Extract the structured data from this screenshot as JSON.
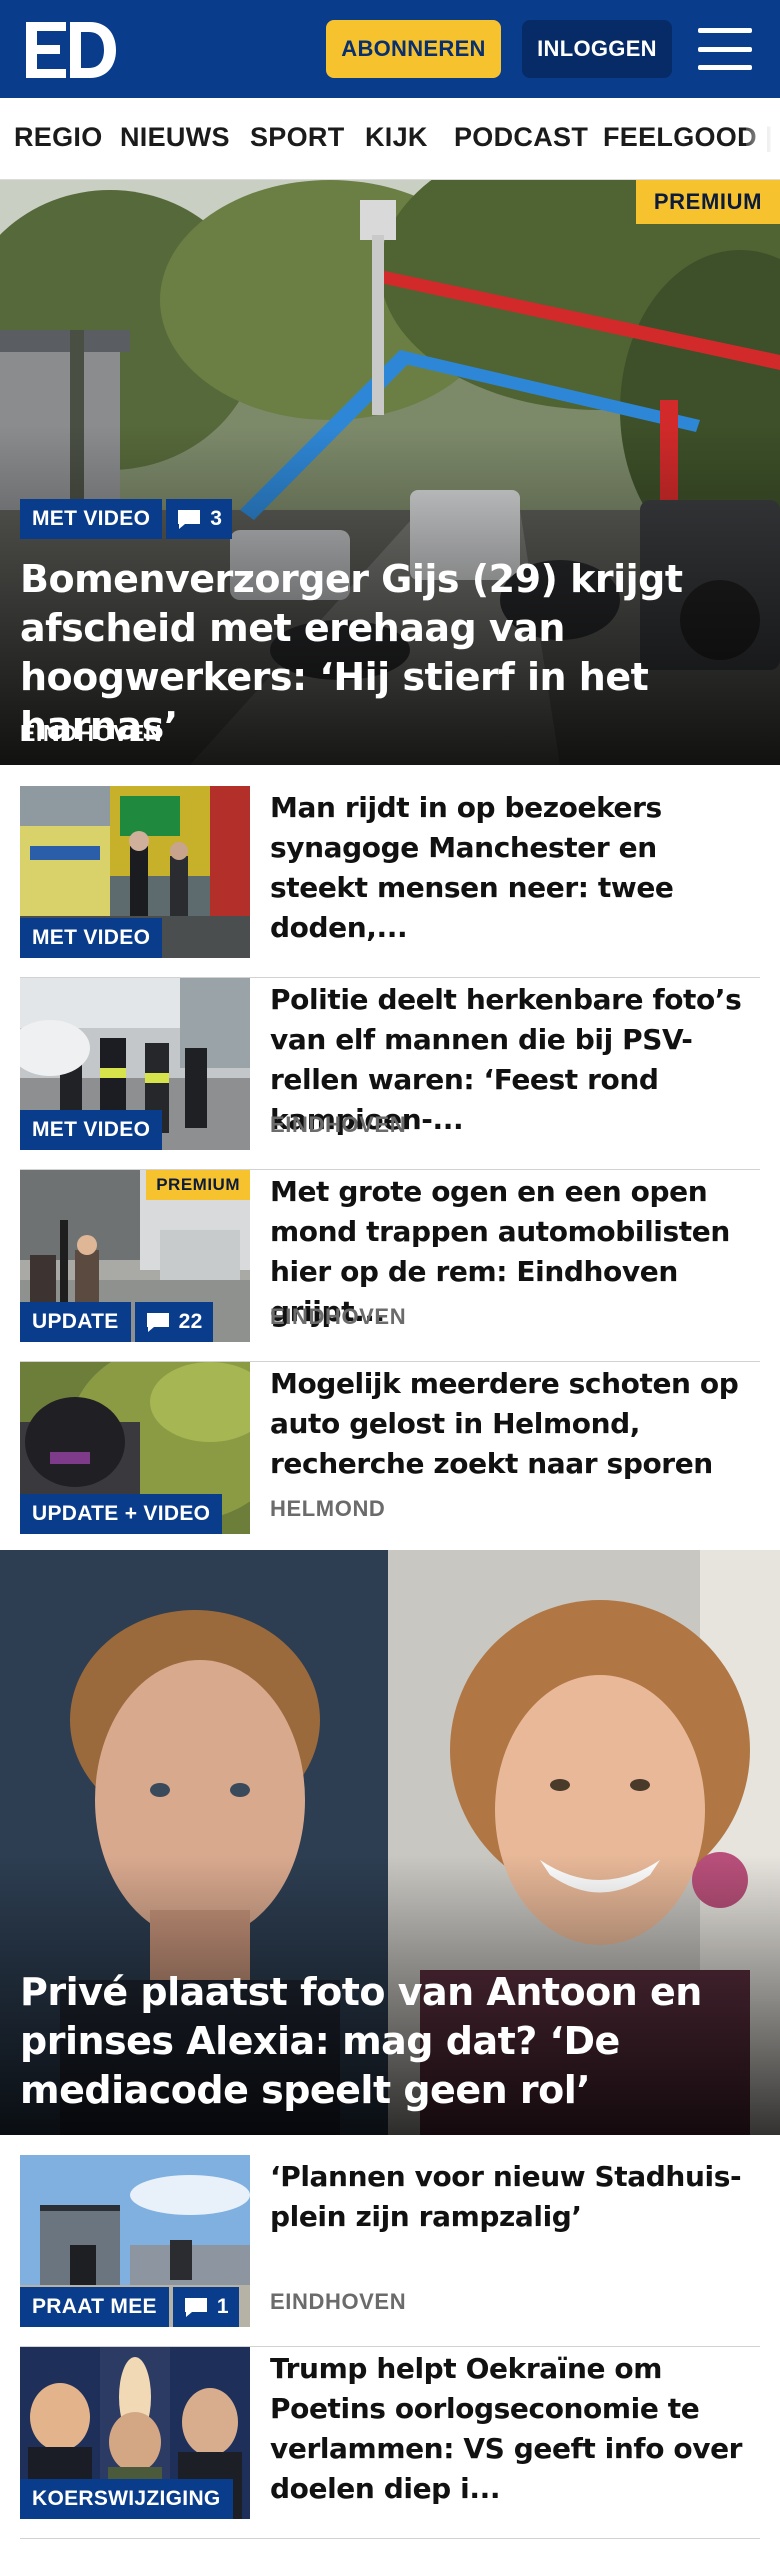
{
  "header": {
    "logo_text": "ED",
    "subscribe_label": "ABONNEREN",
    "login_label": "INLOGGEN",
    "menu_icon": "hamburger-menu-icon",
    "colors": {
      "brand": "#0a3c8c",
      "accent": "#f6c32e"
    }
  },
  "nav": {
    "items": [
      "REGIO",
      "NIEUWS",
      "SPORT",
      "KIJK",
      "PODCAST",
      "FEELGOOD"
    ]
  },
  "hero": {
    "badge": "PREMIUM",
    "video_label": "MET VIDEO",
    "comment_count": "3",
    "title": "Bomenverzorger Gijs (29) krijgt afscheid met erehaag van hoogwer­kers: ‘Hij stierf in het harnas’",
    "place": "EINDHOVEN"
  },
  "articles": [
    {
      "label": "MET VIDEO",
      "title": "Man rijdt in op bezoekers synagoge Manchester en steekt mensen neer: twee doden,...",
      "place": ""
    },
    {
      "label": "MET VIDEO",
      "title": "Politie deelt herkenbare foto’s van elf mannen die bij PSV-rellen waren: ‘Feest rond kampioen-...",
      "place": "EINDHOVEN"
    },
    {
      "label": "UPDATE",
      "premium": "PREMIUM",
      "comment_count": "22",
      "title": "Met grote ogen en een open mond trappen automobilisten hier op de rem: Eindhoven grijpt...",
      "place": "EINDHOVEN"
    },
    {
      "label": "UPDATE + VIDEO",
      "title": "Mogelijk meerdere schoten op auto gelost in Helmond, recherche zoekt naar sporen",
      "place": "HELMOND"
    }
  ],
  "feature": {
    "title": "Privé plaatst foto van Antoon en prinses Alexia: mag dat? ‘De mediacode speelt geen rol’"
  },
  "articles2": [
    {
      "label": "PRAAT MEE",
      "comment_count": "1",
      "title": "‘Plannen voor nieuw Stadhuis­plein zijn rampzalig’",
      "place": "EINDHOVEN"
    },
    {
      "label": "KOERSWIJZIGING",
      "title": "Trump helpt Oekraïne om Poetins oorlogseconomie te verlammen: VS geeft info over doelen diep i...",
      "place": ""
    }
  ]
}
